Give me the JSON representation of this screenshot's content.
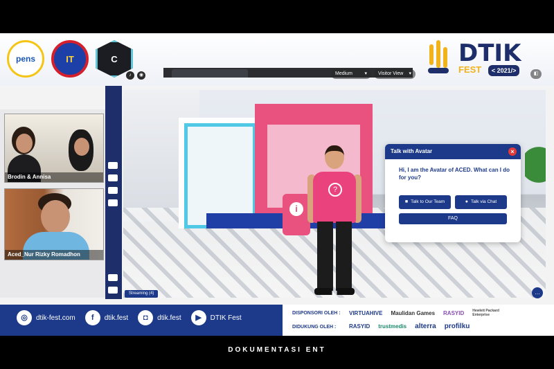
{
  "header": {
    "logos": [
      "pens-logo",
      "it-logo",
      "club-logo"
    ],
    "pens_text": "pens",
    "it_text": "IT",
    "club_text": "C",
    "event_logo": {
      "title": "DTIK",
      "subtitle": "FEST",
      "year": "< 2021/>"
    }
  },
  "participants": [
    {
      "name": "Brodin & Annisa"
    },
    {
      "name": "Aced_Nur Rizky Romadhon"
    }
  ],
  "scene": {
    "quality": "Medium",
    "view_mode": "Visitor View",
    "streaming": "Streaming (4)"
  },
  "dialog": {
    "title": "Talk with Avatar",
    "message": "Hi, I am the Avatar of ACED. What can I do for you?",
    "buttons": [
      "Talk to Our Team",
      "Talk via Chat"
    ],
    "faq": "FAQ"
  },
  "footer": {
    "website": "dtik-fest.com",
    "facebook": "dtik.fest",
    "instagram": "dtik.fest",
    "youtube": "DTIK Fest",
    "sponsored_by": "DISPONSORI OLEH :",
    "supported_by": "DIDUKUNG OLEH :",
    "sponsors": [
      "VIRTUAHIVE",
      "Maulidan Games",
      "RASYID",
      "Hewlett Packard Enterprise"
    ],
    "supporters": [
      "RASYID",
      "trustmedis",
      "alterra",
      "profilku"
    ]
  },
  "caption": "DOKUMENTASI ENT",
  "colors": {
    "brand_navy": "#1d3a8a",
    "accent_pink": "#e9427d",
    "accent_yellow": "#f2b21c"
  }
}
